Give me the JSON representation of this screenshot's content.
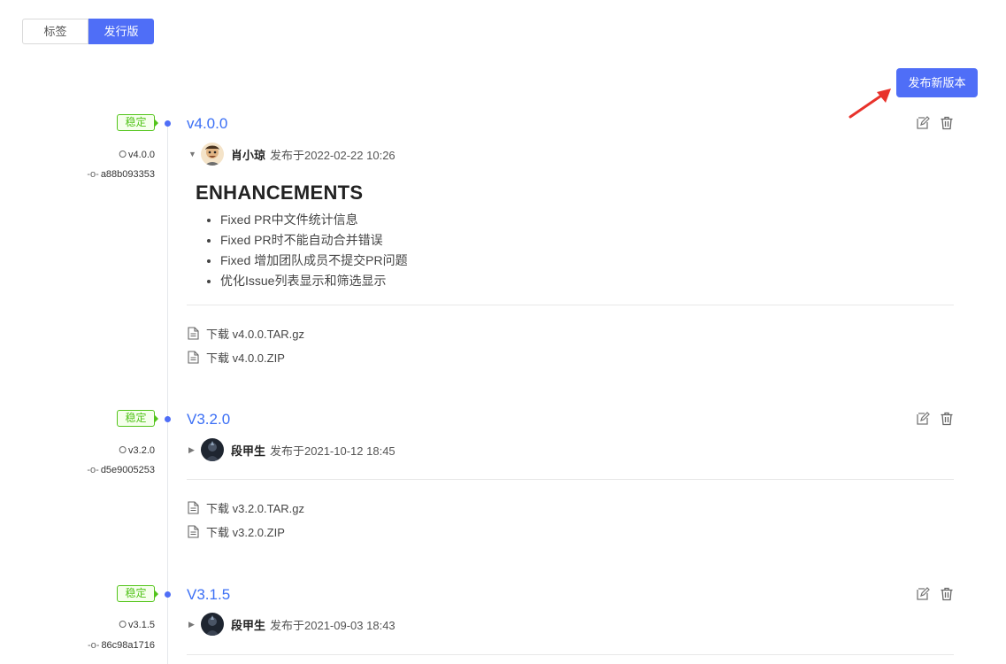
{
  "tabs": [
    {
      "label": "标签",
      "active": false
    },
    {
      "label": "发行版",
      "active": true
    }
  ],
  "publish_button": "发布新版本",
  "colors": {
    "accent": "#4f6ef7",
    "link": "#3b6ff5",
    "stable": "#52c41a",
    "arrow": "#e8322b"
  },
  "releases": [
    {
      "badge": "稳定",
      "title": "v4.0.0",
      "tag": "v4.0.0",
      "commit": "a88b093353",
      "expanded": true,
      "author": "肖小琼",
      "published": "发布于2022-02-22 10:26",
      "notes": {
        "heading": "ENHANCEMENTS",
        "items": [
          "Fixed PR中文件统计信息",
          "Fixed PR时不能自动合并错误",
          "Fixed 增加团队成员不提交PR问题",
          "优化Issue列表显示和筛选显示"
        ]
      },
      "downloads": [
        "下载 v4.0.0.TAR.gz",
        "下载 v4.0.0.ZIP"
      ]
    },
    {
      "badge": "稳定",
      "title": "V3.2.0",
      "tag": "v3.2.0",
      "commit": "d5e9005253",
      "expanded": false,
      "author": "段甲生",
      "published": "发布于2021-10-12 18:45",
      "downloads": [
        "下载 v3.2.0.TAR.gz",
        "下载 v3.2.0.ZIP"
      ]
    },
    {
      "badge": "稳定",
      "title": "V3.1.5",
      "tag": "v3.1.5",
      "commit": "86c98a1716",
      "expanded": false,
      "author": "段甲生",
      "published": "发布于2021-09-03 18:43"
    }
  ],
  "icons": {
    "tag": "tag-icon",
    "commit": "commit-icon",
    "edit": "edit-icon",
    "delete": "trash-icon",
    "file": "file-icon",
    "expanded": "caret-down-icon",
    "collapsed": "caret-right-icon"
  }
}
